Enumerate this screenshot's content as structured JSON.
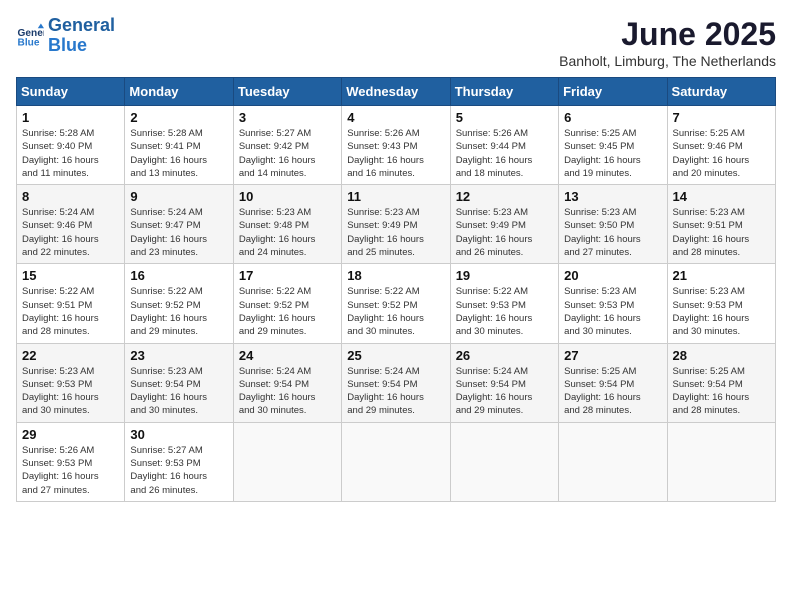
{
  "header": {
    "logo_line1": "General",
    "logo_line2": "Blue",
    "month_title": "June 2025",
    "location": "Banholt, Limburg, The Netherlands"
  },
  "weekdays": [
    "Sunday",
    "Monday",
    "Tuesday",
    "Wednesday",
    "Thursday",
    "Friday",
    "Saturday"
  ],
  "weeks": [
    [
      {
        "day": "1",
        "info": "Sunrise: 5:28 AM\nSunset: 9:40 PM\nDaylight: 16 hours\nand 11 minutes."
      },
      {
        "day": "2",
        "info": "Sunrise: 5:28 AM\nSunset: 9:41 PM\nDaylight: 16 hours\nand 13 minutes."
      },
      {
        "day": "3",
        "info": "Sunrise: 5:27 AM\nSunset: 9:42 PM\nDaylight: 16 hours\nand 14 minutes."
      },
      {
        "day": "4",
        "info": "Sunrise: 5:26 AM\nSunset: 9:43 PM\nDaylight: 16 hours\nand 16 minutes."
      },
      {
        "day": "5",
        "info": "Sunrise: 5:26 AM\nSunset: 9:44 PM\nDaylight: 16 hours\nand 18 minutes."
      },
      {
        "day": "6",
        "info": "Sunrise: 5:25 AM\nSunset: 9:45 PM\nDaylight: 16 hours\nand 19 minutes."
      },
      {
        "day": "7",
        "info": "Sunrise: 5:25 AM\nSunset: 9:46 PM\nDaylight: 16 hours\nand 20 minutes."
      }
    ],
    [
      {
        "day": "8",
        "info": "Sunrise: 5:24 AM\nSunset: 9:46 PM\nDaylight: 16 hours\nand 22 minutes."
      },
      {
        "day": "9",
        "info": "Sunrise: 5:24 AM\nSunset: 9:47 PM\nDaylight: 16 hours\nand 23 minutes."
      },
      {
        "day": "10",
        "info": "Sunrise: 5:23 AM\nSunset: 9:48 PM\nDaylight: 16 hours\nand 24 minutes."
      },
      {
        "day": "11",
        "info": "Sunrise: 5:23 AM\nSunset: 9:49 PM\nDaylight: 16 hours\nand 25 minutes."
      },
      {
        "day": "12",
        "info": "Sunrise: 5:23 AM\nSunset: 9:49 PM\nDaylight: 16 hours\nand 26 minutes."
      },
      {
        "day": "13",
        "info": "Sunrise: 5:23 AM\nSunset: 9:50 PM\nDaylight: 16 hours\nand 27 minutes."
      },
      {
        "day": "14",
        "info": "Sunrise: 5:23 AM\nSunset: 9:51 PM\nDaylight: 16 hours\nand 28 minutes."
      }
    ],
    [
      {
        "day": "15",
        "info": "Sunrise: 5:22 AM\nSunset: 9:51 PM\nDaylight: 16 hours\nand 28 minutes."
      },
      {
        "day": "16",
        "info": "Sunrise: 5:22 AM\nSunset: 9:52 PM\nDaylight: 16 hours\nand 29 minutes."
      },
      {
        "day": "17",
        "info": "Sunrise: 5:22 AM\nSunset: 9:52 PM\nDaylight: 16 hours\nand 29 minutes."
      },
      {
        "day": "18",
        "info": "Sunrise: 5:22 AM\nSunset: 9:52 PM\nDaylight: 16 hours\nand 30 minutes."
      },
      {
        "day": "19",
        "info": "Sunrise: 5:22 AM\nSunset: 9:53 PM\nDaylight: 16 hours\nand 30 minutes."
      },
      {
        "day": "20",
        "info": "Sunrise: 5:23 AM\nSunset: 9:53 PM\nDaylight: 16 hours\nand 30 minutes."
      },
      {
        "day": "21",
        "info": "Sunrise: 5:23 AM\nSunset: 9:53 PM\nDaylight: 16 hours\nand 30 minutes."
      }
    ],
    [
      {
        "day": "22",
        "info": "Sunrise: 5:23 AM\nSunset: 9:53 PM\nDaylight: 16 hours\nand 30 minutes."
      },
      {
        "day": "23",
        "info": "Sunrise: 5:23 AM\nSunset: 9:54 PM\nDaylight: 16 hours\nand 30 minutes."
      },
      {
        "day": "24",
        "info": "Sunrise: 5:24 AM\nSunset: 9:54 PM\nDaylight: 16 hours\nand 30 minutes."
      },
      {
        "day": "25",
        "info": "Sunrise: 5:24 AM\nSunset: 9:54 PM\nDaylight: 16 hours\nand 29 minutes."
      },
      {
        "day": "26",
        "info": "Sunrise: 5:24 AM\nSunset: 9:54 PM\nDaylight: 16 hours\nand 29 minutes."
      },
      {
        "day": "27",
        "info": "Sunrise: 5:25 AM\nSunset: 9:54 PM\nDaylight: 16 hours\nand 28 minutes."
      },
      {
        "day": "28",
        "info": "Sunrise: 5:25 AM\nSunset: 9:54 PM\nDaylight: 16 hours\nand 28 minutes."
      }
    ],
    [
      {
        "day": "29",
        "info": "Sunrise: 5:26 AM\nSunset: 9:53 PM\nDaylight: 16 hours\nand 27 minutes."
      },
      {
        "day": "30",
        "info": "Sunrise: 5:27 AM\nSunset: 9:53 PM\nDaylight: 16 hours\nand 26 minutes."
      },
      {
        "day": "",
        "info": ""
      },
      {
        "day": "",
        "info": ""
      },
      {
        "day": "",
        "info": ""
      },
      {
        "day": "",
        "info": ""
      },
      {
        "day": "",
        "info": ""
      }
    ]
  ]
}
